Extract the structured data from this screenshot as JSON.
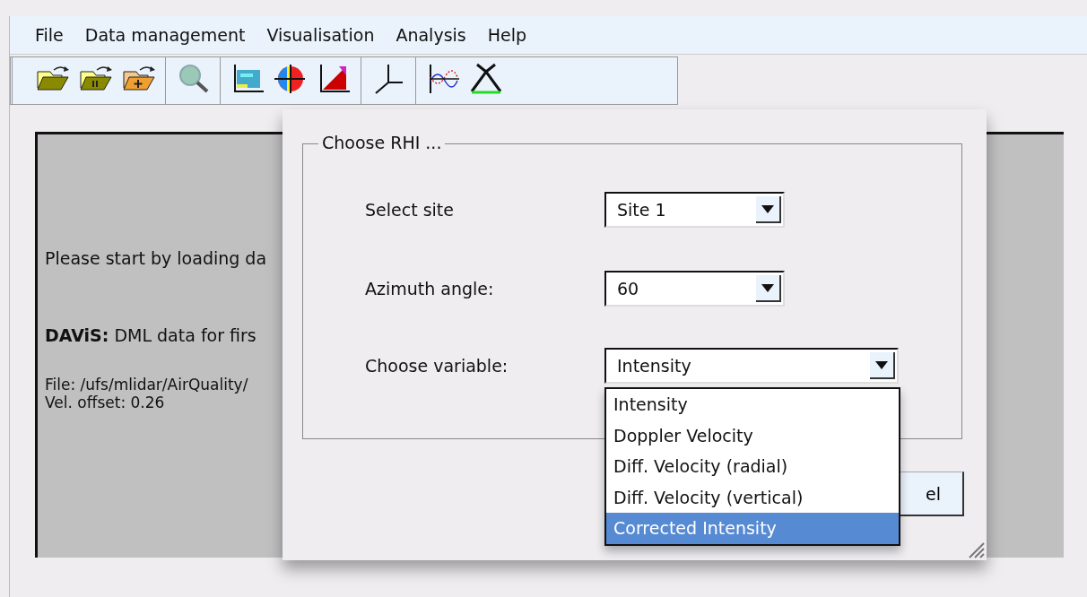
{
  "menu": [
    {
      "label": "File"
    },
    {
      "label": "Data management"
    },
    {
      "label": "Visualisation"
    },
    {
      "label": "Analysis"
    },
    {
      "label": "Help"
    }
  ],
  "info_panel": {
    "lines": [
      "Please start by loading da",
      "**DAViS:** DML data for firs",
      "File: /ufs/mlidar/AirQuality/",
      "Vel. offset: 0.26"
    ]
  },
  "dialog": {
    "group_title": "Choose RHI ...",
    "fields": [
      {
        "label": "Select site",
        "value": "Site 1"
      },
      {
        "label": "Azimuth angle:",
        "value": "60"
      },
      {
        "label": "Choose variable:",
        "value": "Intensity"
      }
    ],
    "dropdown": {
      "options": [
        {
          "label": "Intensity",
          "selected": false
        },
        {
          "label": "Doppler Velocity",
          "selected": false
        },
        {
          "label": "Diff. Velocity (radial)",
          "selected": false
        },
        {
          "label": "Diff. Velocity (vertical)",
          "selected": false
        },
        {
          "label": "Corrected Intensity",
          "selected": true
        }
      ]
    },
    "button": {
      "label": "el"
    }
  }
}
